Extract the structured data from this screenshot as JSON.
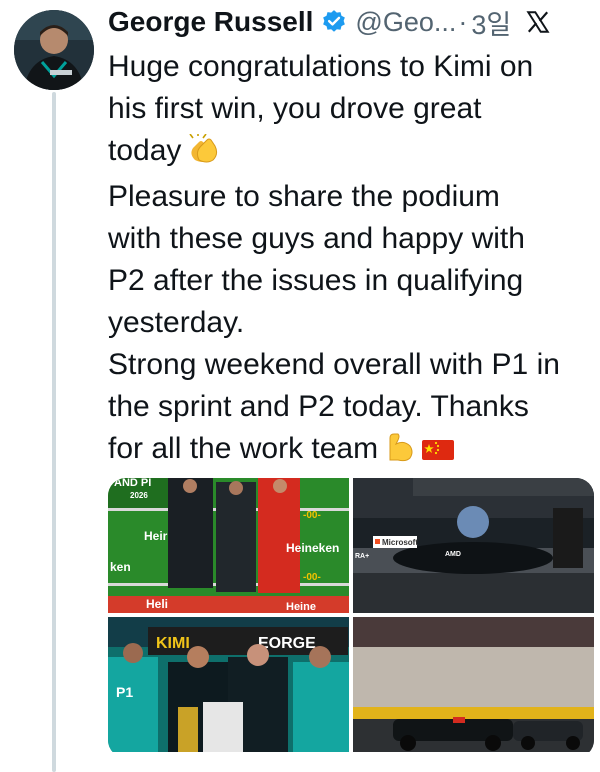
{
  "tweet": {
    "author_name": "George Russell",
    "handle": "@Geo...",
    "separator": "·",
    "timestamp": "3일",
    "text_lines": [
      "Huge congratulations to Kimi on",
      "his first win, you drove great",
      "today",
      "Pleasure to share the podium",
      "with these guys and happy with",
      "P2 after the issues in qualifying",
      "yesterday.",
      "Strong weekend overall with P1 in",
      "the sprint and P2 today. Thanks",
      "for all the work team"
    ],
    "emojis": [
      "clapping-hands",
      "flexed-biceps",
      "china-flag"
    ]
  },
  "media": {
    "image1_texts": [
      "AND PI",
      "2026",
      "Heir",
      "Heineken",
      "ken",
      "-00-",
      "-00-",
      "Heli",
      "Heine"
    ],
    "image2_texts": [
      "Microsoft",
      "RA+",
      "AMD"
    ],
    "image3_texts": [
      "KIMI",
      "EORGE",
      "P1"
    ],
    "image4_texts": []
  },
  "colors": {
    "text": "#0f1419",
    "secondary": "#536471",
    "verified": "#1d9bf0",
    "thread_line": "#cfd9de",
    "heineken_green": "#2a8a2a",
    "petronas_teal": "#00a19b"
  }
}
